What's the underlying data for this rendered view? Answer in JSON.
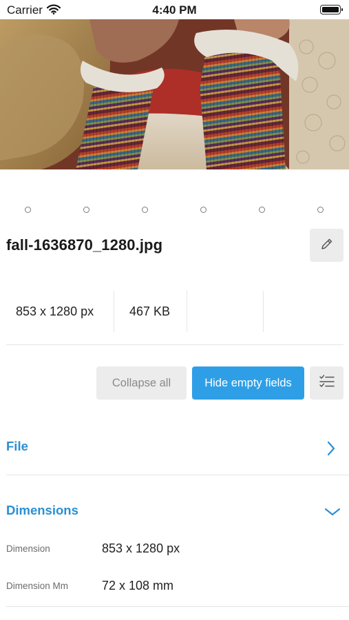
{
  "status_bar": {
    "carrier": "Carrier",
    "time": "4:40 PM",
    "wifi_icon": "wifi-icon",
    "battery_icon": "battery-icon"
  },
  "photo": {
    "description_icon": "photo-preview",
    "page_count": 6,
    "current_page": 0
  },
  "file": {
    "name": "fall-1636870_1280.jpg",
    "edit_icon": "pencil-icon"
  },
  "stats": {
    "dimensions": "853 x 1280 px",
    "size": "467 KB",
    "slot3": "",
    "slot4": ""
  },
  "actions": {
    "collapse_all": "Collapse all",
    "hide_empty": "Hide empty fields",
    "checklist_icon": "checklist-icon"
  },
  "sections": {
    "file": {
      "title": "File",
      "state": "collapsed",
      "icon": "chevron-right-icon"
    },
    "dimensions": {
      "title": "Dimensions",
      "state": "expanded",
      "icon": "chevron-down-icon",
      "fields": [
        {
          "label": "Dimension",
          "value": "853 x 1280 px"
        },
        {
          "label": "Dimension Mm",
          "value": "72 x 108 mm"
        }
      ]
    }
  },
  "colors": {
    "accent": "#2e9fe6",
    "section_title": "#2a8fd0",
    "button_gray": "#ececec"
  }
}
